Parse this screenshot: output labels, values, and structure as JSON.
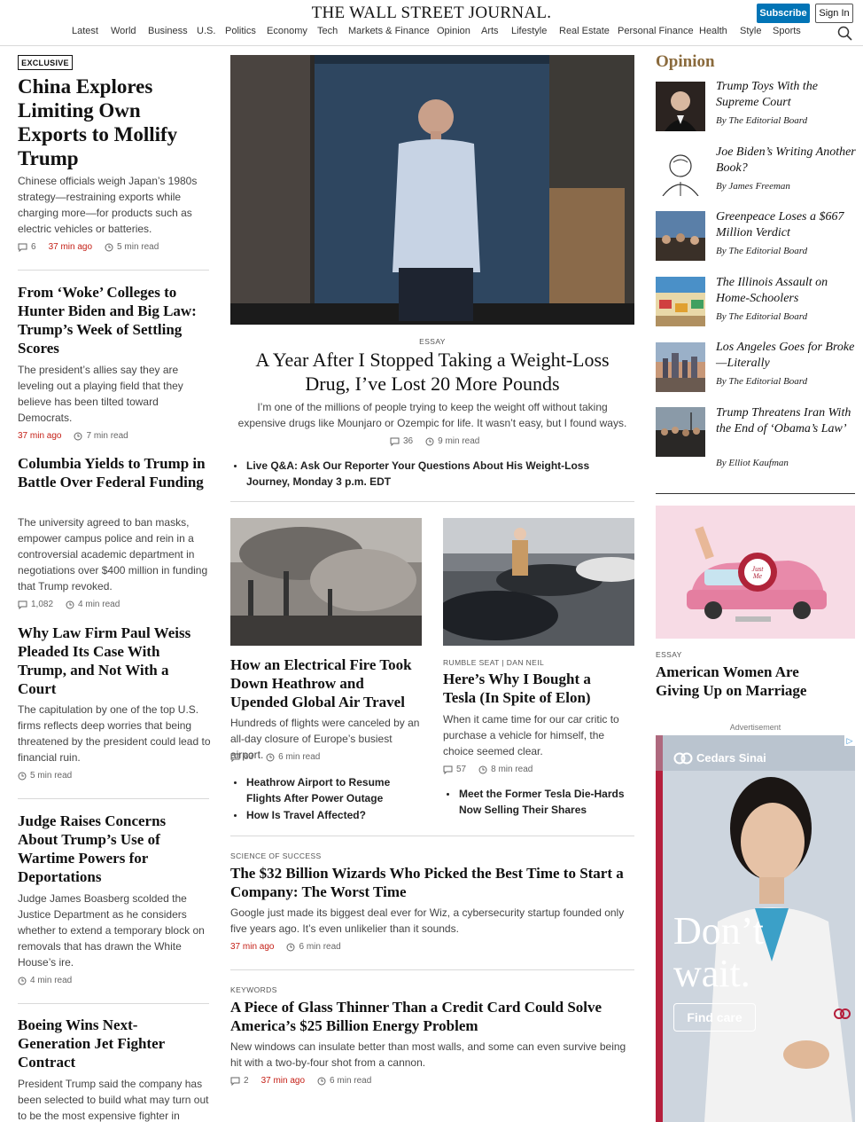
{
  "masthead": {
    "title": "THE WALL STREET JOURNAL.",
    "subscribe": "Subscribe",
    "sign_in": "Sign In"
  },
  "nav": [
    "Latest",
    "World",
    "Business",
    "U.S.",
    "Politics",
    "Economy",
    "Tech",
    "Markets & Finance",
    "Opinion",
    "Arts",
    "Lifestyle",
    "Real Estate",
    "Personal Finance",
    "Health",
    "Style",
    "Sports"
  ],
  "left": [
    {
      "badge": "EXCLUSIVE",
      "headline": "China Explores Limiting Own Exports to Mollify Trump",
      "summary": "Chinese officials weigh Japan’s 1980s strategy—restraining exports while charging more—for products such as electric vehicles or batteries.",
      "comments": "6",
      "time": "37 min ago",
      "read": "5 min read"
    },
    {
      "headline": "From ‘Woke’ Colleges to Hunter Biden and Big Law: Trump’s Week of Settling Scores",
      "summary": "The president’s allies say they are leveling out a playing field that they believe has been tilted toward Democrats.",
      "time": "37 min ago",
      "read": "7 min read"
    },
    {
      "headline": "Columbia Yields to Trump in Battle Over Federal Funding",
      "summary": "The university agreed to ban masks, empower campus police and rein in a controversial academic department in negotiations over $400 million in funding that Trump revoked.",
      "comments": "1,082",
      "read": "4 min read"
    },
    {
      "headline": "Why Law Firm Paul Weiss Pleaded Its Case With Trump, and Not With a Court",
      "summary": "The capitulation by one of the top U.S. firms reflects deep worries that being threatened by the president could lead to financial ruin.",
      "read": "5 min read"
    },
    {
      "headline": "Judge Raises Concerns About Trump’s Use of Wartime Powers for Deportations",
      "summary": "Judge James Boasberg scolded the Justice Department as he considers whether to extend a temporary block on removals that has drawn the White House’s ire.",
      "read": "4 min read"
    },
    {
      "headline": "Boeing Wins Next-Generation Jet Fighter Contract",
      "summary": "President Trump said the company has been selected to build what may turn out to be the most expensive fighter in"
    }
  ],
  "center": {
    "lead": {
      "kicker": "ESSAY",
      "headline": "A Year After I Stopped Taking a Weight-Loss Drug, I’ve Lost 20 More Pounds",
      "summary": "I’m one of the millions of people trying to keep the weight off without taking expensive drugs like Mounjaro or Ozempic for life. It wasn’t easy, but I found ways.",
      "comments": "36",
      "read": "9 min read",
      "bullet": "Live Q&A: Ask Our Reporter Your Questions About His Weight-Loss Journey, Monday 3 p.m. EDT"
    },
    "heathrow": {
      "headline": "How an Electrical Fire Took Down Heathrow and Upended Global Air Travel",
      "summary": "Hundreds of flights were canceled by an all-day closure of Europe’s busiest airport.",
      "comments": "63",
      "read": "6 min read",
      "bullets": [
        "Heathrow Airport to Resume Flights After Power Outage",
        "How Is Travel Affected?"
      ]
    },
    "tesla": {
      "kicker": "RUMBLE SEAT | DAN NEIL",
      "headline": "Here’s Why I Bought a Tesla (In Spite of Elon)",
      "summary": "When it came time for our car critic to purchase a vehicle for himself, the choice seemed clear.",
      "comments": "57",
      "read": "8 min read",
      "bullet": "Meet the Former Tesla Die-Hards Now Selling Their Shares"
    },
    "wiz": {
      "kicker": "SCIENCE OF SUCCESS",
      "headline": "The $32 Billion Wizards Who Picked the Best Time to Start a Company: The Worst Time",
      "summary": "Google just made its biggest deal ever for Wiz, a cybersecurity startup founded only five years ago. It’s even unlikelier than it sounds.",
      "time": "37 min ago",
      "read": "6 min read"
    },
    "glass": {
      "kicker": "KEYWORDS",
      "headline": "A Piece of Glass Thinner Than a Credit Card Could Solve America’s $25 Billion Energy Problem",
      "summary": "New windows can insulate better than most walls, and some can even survive being hit with a two-by-four shot from a cannon.",
      "comments": "2",
      "time": "37 min ago",
      "read": "6 min read"
    }
  },
  "opinion": {
    "heading": "Opinion",
    "items": [
      {
        "title": "Trump Toys With the Supreme Court",
        "author": "By The Editorial Board"
      },
      {
        "title": "Joe Biden’s Writing Another Book?",
        "author": "By James Freeman"
      },
      {
        "title": "Greenpeace Loses a $667 Million Verdict",
        "author": "By The Editorial Board"
      },
      {
        "title": "The Illinois Assault on Home-Schoolers",
        "author": "By The Editorial Board"
      },
      {
        "title": "Los Angeles Goes for Broke—Literally",
        "author": "By The Editorial Board"
      },
      {
        "title": "Trump Threatens Iran With the End of ‘Obama’s Law’",
        "author": "By Elliot Kaufman"
      }
    ],
    "essay": {
      "kicker": "ESSAY",
      "headline": "American Women Are Giving Up on Marriage",
      "car_sign": "Just Me"
    }
  },
  "ad": {
    "label": "Advertisement",
    "brand": "Cedars Sinai",
    "headline_1": "Don’t",
    "headline_2": "wait.",
    "cta": "Find care"
  },
  "colors": {
    "accent_blue": "#0274b6",
    "time_red": "#c41e15",
    "opinion_gold": "#8a6a3c"
  }
}
